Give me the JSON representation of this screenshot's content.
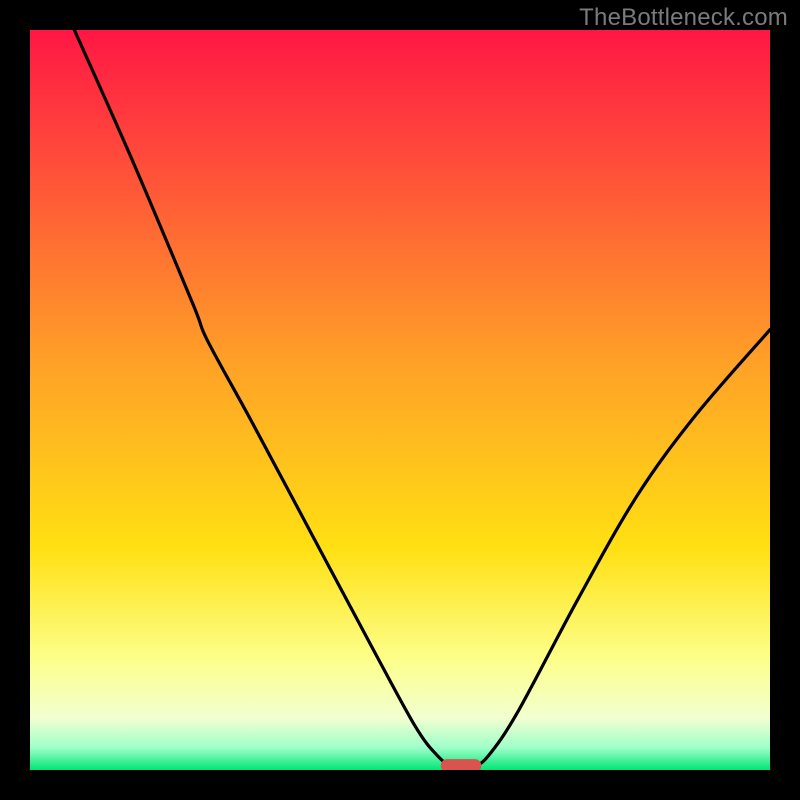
{
  "watermark": "TheBottleneck.com",
  "colors": {
    "background": "#000000",
    "gradient_top": "#ff1744",
    "gradient_upper": "#ff4d3a",
    "gradient_mid_upper": "#ffa127",
    "gradient_mid": "#ffe013",
    "gradient_lower": "#fdff8a",
    "gradient_pale": "#f2ffd0",
    "gradient_green": "#00e676",
    "curve": "#000000",
    "marker_fill": "#d9534f",
    "watermark": "#7b7b7b"
  },
  "chart_data": {
    "type": "line",
    "title": "",
    "xlabel": "",
    "ylabel": "",
    "xlim": [
      0,
      100
    ],
    "ylim": [
      0,
      100
    ],
    "grid": false,
    "legend": false,
    "series": [
      {
        "name": "bottleneck-curve",
        "points": [
          {
            "x": 6.0,
            "y": 100.0
          },
          {
            "x": 14.0,
            "y": 82.0
          },
          {
            "x": 22.0,
            "y": 63.0
          },
          {
            "x": 24.0,
            "y": 58.0
          },
          {
            "x": 30.0,
            "y": 47.0
          },
          {
            "x": 38.0,
            "y": 32.0
          },
          {
            "x": 46.0,
            "y": 17.0
          },
          {
            "x": 52.0,
            "y": 6.0
          },
          {
            "x": 55.0,
            "y": 2.0
          },
          {
            "x": 57.0,
            "y": 0.6
          },
          {
            "x": 60.0,
            "y": 0.6
          },
          {
            "x": 62.0,
            "y": 2.0
          },
          {
            "x": 66.0,
            "y": 8.0
          },
          {
            "x": 74.0,
            "y": 23.0
          },
          {
            "x": 82.0,
            "y": 37.0
          },
          {
            "x": 90.0,
            "y": 48.0
          },
          {
            "x": 100.0,
            "y": 59.5
          }
        ]
      }
    ],
    "marker": {
      "x_start": 55.5,
      "x_end": 61.0,
      "y": 0.6
    },
    "gradient_stops_percent_from_top": [
      {
        "offset": 0,
        "value": 100
      },
      {
        "offset": 18,
        "value": 82
      },
      {
        "offset": 45,
        "value": 55
      },
      {
        "offset": 70,
        "value": 30
      },
      {
        "offset": 85,
        "value": 15
      },
      {
        "offset": 93,
        "value": 7
      },
      {
        "offset": 97,
        "value": 3
      },
      {
        "offset": 100,
        "value": 0
      }
    ]
  }
}
